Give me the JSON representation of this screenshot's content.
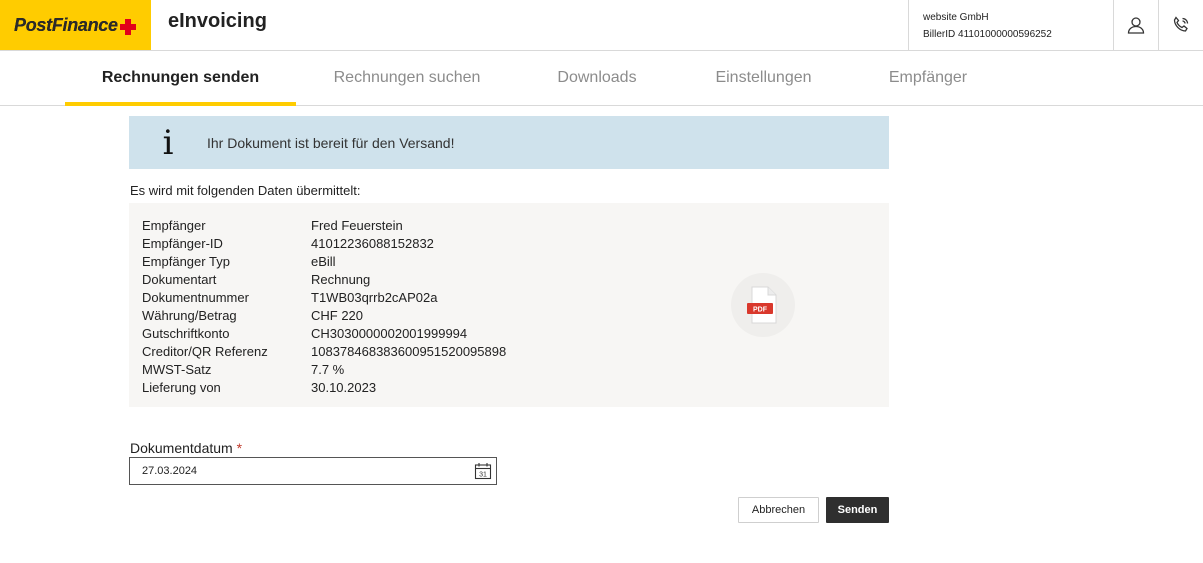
{
  "header": {
    "logo_text_1": "Post",
    "logo_text_2": "Finance",
    "app_title": "eInvoicing",
    "company": "website GmbH",
    "biller_id": "BillerID 41101000000596252"
  },
  "nav": {
    "tabs": [
      {
        "label": "Rechnungen senden",
        "active": true
      },
      {
        "label": "Rechnungen suchen",
        "active": false
      },
      {
        "label": "Downloads",
        "active": false
      },
      {
        "label": "Einstellungen",
        "active": false
      },
      {
        "label": "Empfänger",
        "active": false
      }
    ]
  },
  "banner": {
    "icon": "info-icon",
    "text": "Ihr Dokument ist bereit für den Versand!"
  },
  "intro": "Es wird mit folgenden Daten übermittelt:",
  "details": [
    {
      "key": "Empfänger",
      "value": "Fred Feuerstein"
    },
    {
      "key": "Empfänger-ID",
      "value": "41012236088152832"
    },
    {
      "key": "Empfänger Typ",
      "value": "eBill"
    },
    {
      "key": "Dokumentart",
      "value": "Rechnung"
    },
    {
      "key": "Dokumentnummer",
      "value": "T1WB03qrrb2cAP02a"
    },
    {
      "key": "Währung/Betrag",
      "value": "CHF 220"
    },
    {
      "key": "Gutschriftkonto",
      "value": "CH3030000002001999994"
    },
    {
      "key": "Creditor/QR Referenz",
      "value": "108378468383600951520095898"
    },
    {
      "key": "MWST-Satz",
      "value": "7.7 %"
    },
    {
      "key": "Lieferung von",
      "value": "30.10.2023"
    }
  ],
  "pdf": {
    "label": "PDF",
    "icon": "pdf-file-icon"
  },
  "date": {
    "label": "Dokumentdatum",
    "required_mark": "*",
    "value": "27.03.2024",
    "calendar_day": "31"
  },
  "buttons": {
    "cancel": "Abbrechen",
    "send": "Senden"
  },
  "colors": {
    "brand_yellow": "#ffcc00",
    "brand_red": "#e2001a",
    "banner_bg": "#cfe2ec",
    "panel_bg": "#f7f6f4",
    "primary_button": "#2f2f2f"
  }
}
